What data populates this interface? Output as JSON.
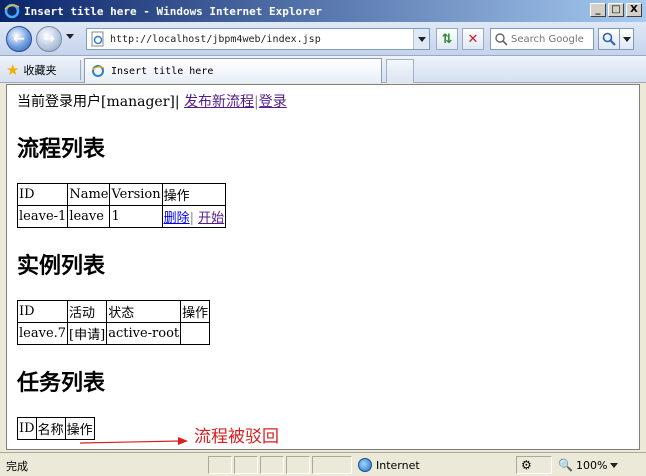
{
  "window": {
    "title": "Insert title here - Windows Internet Explorer",
    "minimize": "_",
    "maximize": "□",
    "close": "X"
  },
  "navbar": {
    "url": "http://localhost/jbpm4web/index.jsp",
    "search_placeholder": "Search Google"
  },
  "tabbar": {
    "favorites_label": "收藏夹",
    "tab_title": "Insert title here"
  },
  "page": {
    "user_prefix": "当前登录用户[manager]|",
    "link_deploy": "发布新流程",
    "sep": "|",
    "link_login": "登录",
    "process_heading": "流程列表",
    "process_table": {
      "headers": [
        "ID",
        "Name",
        "Version",
        "操作"
      ],
      "rows": [
        {
          "id": "leave-1",
          "name": "leave",
          "version": "1",
          "action_delete": "删除",
          "action_sep": "|",
          "action_start": "开始"
        }
      ]
    },
    "instance_heading": "实例列表",
    "instance_table": {
      "headers": [
        "ID",
        "活动",
        "状态",
        "操作"
      ],
      "rows": [
        {
          "id": "leave.7",
          "activity": "[申请]",
          "state": "active-root",
          "action": ""
        }
      ]
    },
    "task_heading": "任务列表",
    "task_table": {
      "headers": [
        "ID",
        "名称",
        "操作"
      ]
    }
  },
  "annotation": {
    "text": "流程被驳回",
    "color": "#d81e1e"
  },
  "statusbar": {
    "status": "完成",
    "zone": "Internet",
    "zoom": "100%"
  }
}
